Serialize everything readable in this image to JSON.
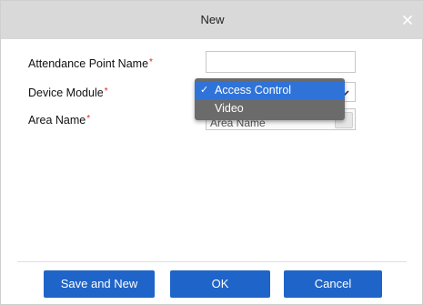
{
  "dialog": {
    "title": "New"
  },
  "form": {
    "attendance_point_name": {
      "label": "Attendance Point Name",
      "required_mark": "*",
      "value": ""
    },
    "device_module": {
      "label": "Device Module",
      "required_mark": "*",
      "selected": "Access Control"
    },
    "area_name": {
      "label": "Area Name",
      "required_mark": "*",
      "value": "Area Name"
    }
  },
  "dropdown": {
    "options": [
      {
        "label": "Access Control",
        "checked": true,
        "check_glyph": "✓"
      },
      {
        "label": "Video",
        "checked": false,
        "check_glyph": ""
      }
    ]
  },
  "buttons": {
    "save_and_new": "Save and New",
    "ok": "OK",
    "cancel": "Cancel"
  },
  "colors": {
    "title_bar": "#d9d9d9",
    "button": "#1f64c8",
    "dropdown_bg": "#6b6b6b",
    "dropdown_selected": "#2f73d8",
    "required": "#e02020"
  },
  "icons": {
    "close": "close-icon",
    "select_arrow": "chevron-down-icon",
    "check": "checkmark-icon"
  }
}
